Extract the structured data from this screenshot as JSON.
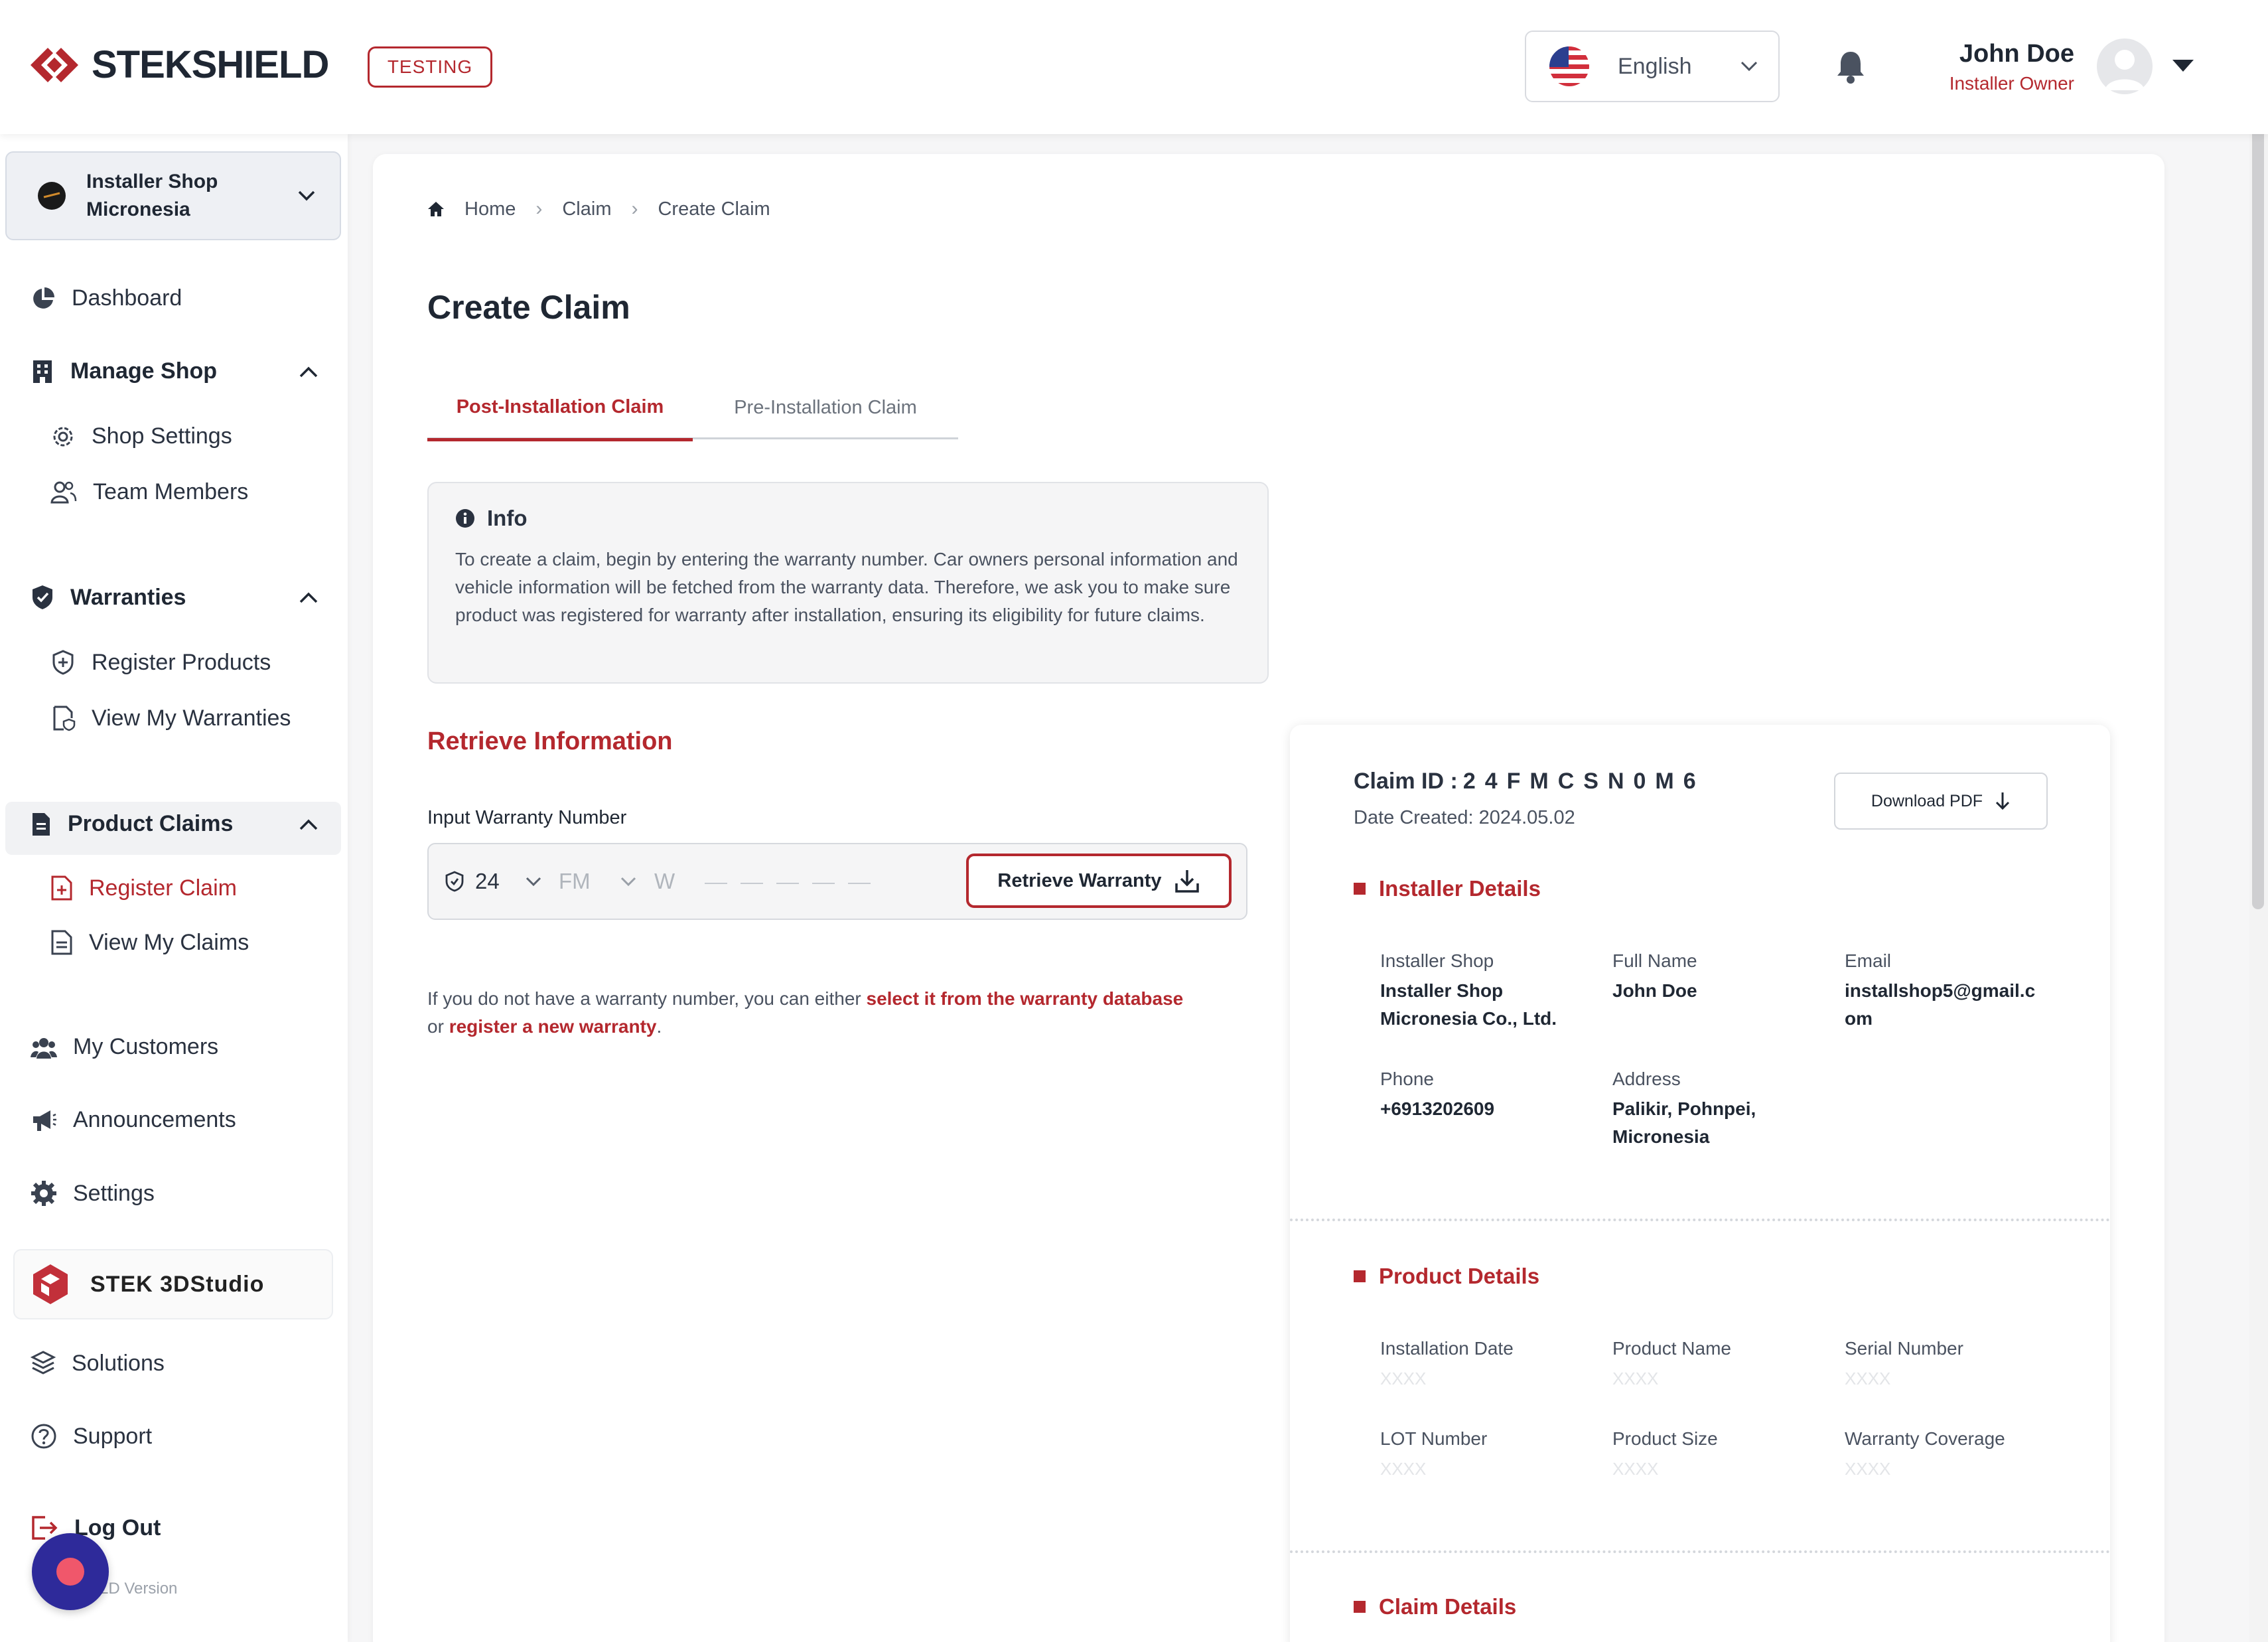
{
  "header": {
    "brand": "STEKSHIELD",
    "env_badge": "TESTING",
    "language": "English",
    "user": {
      "name": "John Doe",
      "role": "Installer Owner"
    }
  },
  "sidebar": {
    "shop_switcher": "Installer Shop Micronesia",
    "items": [
      {
        "label": "Dashboard",
        "icon": "pie-chart-icon"
      },
      {
        "label": "Manage Shop",
        "icon": "building-icon",
        "expanded": true
      },
      {
        "label": "Shop Settings",
        "icon": "gear-icon"
      },
      {
        "label": "Team Members",
        "icon": "users-icon"
      },
      {
        "label": "Warranties",
        "icon": "shield-check-icon",
        "expanded": true
      },
      {
        "label": "Register Products",
        "icon": "shield-plus-icon"
      },
      {
        "label": "View My Warranties",
        "icon": "document-shield-icon"
      },
      {
        "label": "Product Claims",
        "icon": "document-icon",
        "expanded": true
      },
      {
        "label": "Register Claim",
        "icon": "document-plus-icon",
        "active": true
      },
      {
        "label": "View My Claims",
        "icon": "document-list-icon"
      },
      {
        "label": "My Customers",
        "icon": "customers-icon"
      },
      {
        "label": "Announcements",
        "icon": "megaphone-icon"
      },
      {
        "label": "Settings",
        "icon": "settings-gear-icon"
      },
      {
        "label": "Solutions",
        "icon": "layers-icon"
      },
      {
        "label": "Support",
        "icon": "question-circle-icon"
      },
      {
        "label": "Log Out",
        "icon": "logout-icon"
      }
    ],
    "studio_label": "STEK 3DStudio",
    "version_text": "LD Version"
  },
  "breadcrumb": [
    "Home",
    "Claim",
    "Create Claim"
  ],
  "page_title": "Create Claim",
  "tabs": [
    {
      "label": "Post-Installation Claim",
      "active": true
    },
    {
      "label": "Pre-Installation Claim",
      "active": false
    }
  ],
  "info": {
    "title": "Info",
    "text": "To create a claim, begin by entering the warranty number. Car owners personal information and vehicle information will be fetched from the warranty data. Therefore, we ask you to make sure product was registered for warranty after installation, ensuring its eligibility for future claims."
  },
  "retrieve": {
    "title": "Retrieve Information",
    "input_label": "Input Warranty Number",
    "year_value": "24",
    "type_placeholder": "FM",
    "prefix": "W",
    "button": "Retrieve Warranty"
  },
  "help": {
    "part1": "If you do not have a warranty number, you can either ",
    "link1": "select it from the warranty database",
    "part2": " or ",
    "link2": "register a new warranty",
    "part3": "."
  },
  "claim": {
    "id_label": "Claim ID :",
    "id_value": "24FMCSN0M6",
    "date_created": "Date Created: 2024.05.02",
    "download": "Download PDF",
    "installer_title": "Installer Details",
    "installer": {
      "shop_label": "Installer Shop",
      "shop_value": "Installer Shop Micronesia Co., Ltd.",
      "fullname_label": "Full Name",
      "fullname_value": "John Doe",
      "email_label": "Email",
      "email_value": "installshop5@gmail.com",
      "phone_label": "Phone",
      "phone_value": "+6913202609",
      "address_label": "Address",
      "address_value": "Palikir, Pohnpei, Micronesia"
    },
    "product_title": "Product Details",
    "product": {
      "install_date_label": "Installation Date",
      "product_name_label": "Product Name",
      "serial_label": "Serial Number",
      "lot_label": "LOT Number",
      "size_label": "Product Size",
      "coverage_label": "Warranty Coverage",
      "placeholder": "XXXX"
    },
    "claim_details_title": "Claim Details"
  },
  "colors": {
    "accent": "#b4282e",
    "text": "#1f2733",
    "muted": "#4a5260"
  }
}
